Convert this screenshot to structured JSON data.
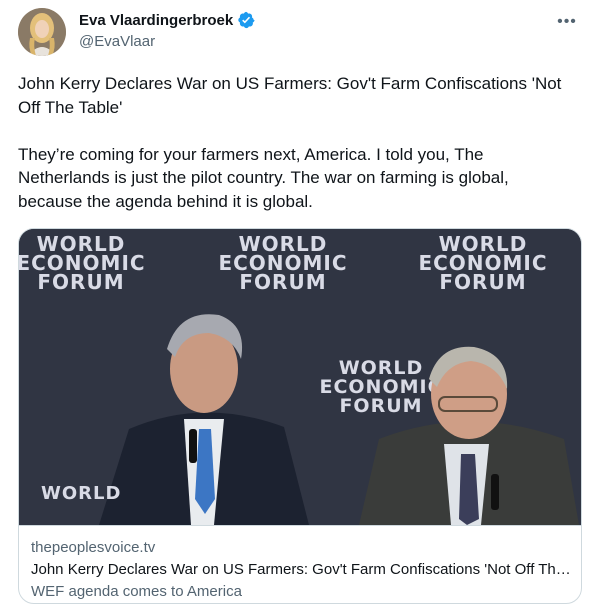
{
  "author": {
    "display_name": "Eva Vlaardingerbroek",
    "handle": "@EvaVlaar",
    "verified": true,
    "verified_color": "#1d9bf0"
  },
  "more_icon": "more-horizontal-icon",
  "tweet": {
    "paragraphs": [
      "John Kerry Declares War on US Farmers: Gov't Farm Confiscations 'Not Off The Table'",
      "They’re coming for your farmers next, America. I told you, The Netherlands is just the pilot country. The war on farming is global, because the agenda behind it is global."
    ]
  },
  "link_card": {
    "image_text": {
      "line1": "WORLD",
      "line2": "ECONOMIC",
      "line3": "FORUM"
    },
    "domain": "thepeoplesvoice.tv",
    "title": "John Kerry Declares War on US Farmers: Gov't Farm Confiscations 'Not Off The Table'",
    "description": "WEF agenda comes to America"
  }
}
